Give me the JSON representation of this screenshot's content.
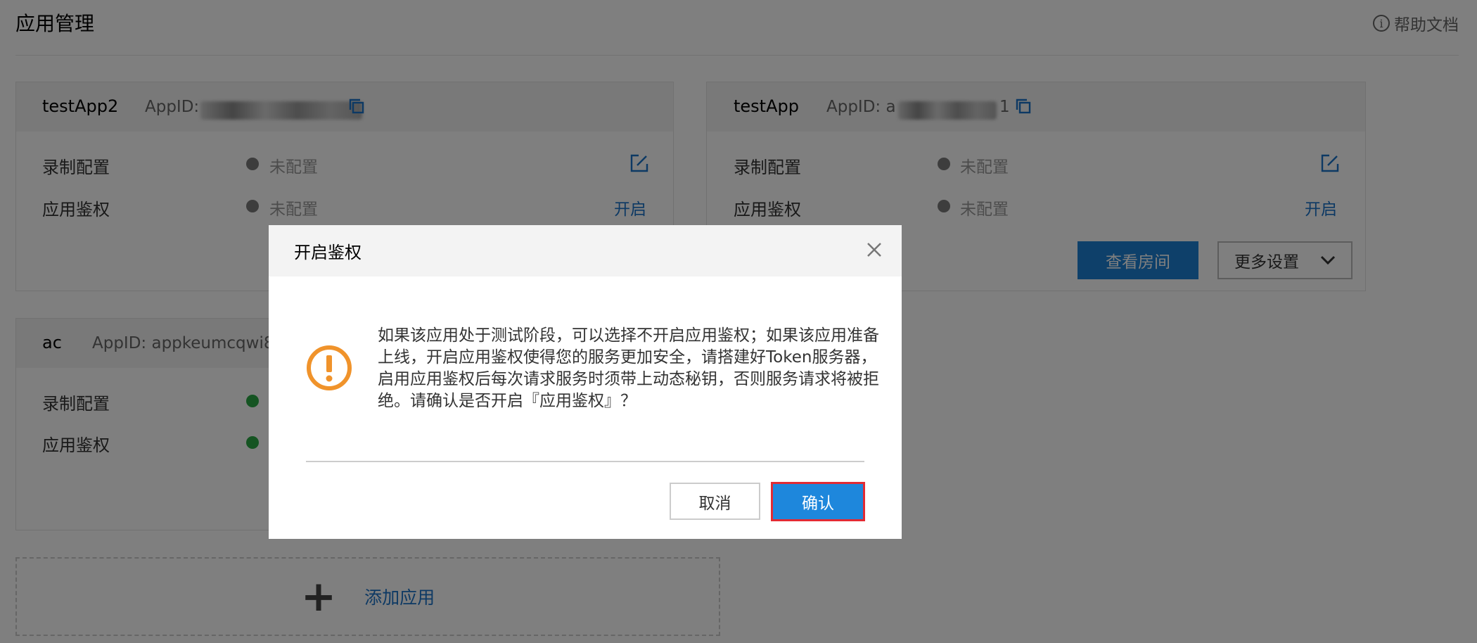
{
  "header": {
    "title": "应用管理",
    "help_label": "帮助文档",
    "help_icon": "info-icon"
  },
  "apps": [
    {
      "name": "testApp2",
      "appid_label": "AppID:",
      "appid_value": "",
      "rows": [
        {
          "label": "录制配置",
          "status": "未配置",
          "status_color": "#7a7a7a",
          "action": "edit-icon"
        },
        {
          "label": "应用鉴权",
          "status": "未配置",
          "status_color": "#7a7a7a",
          "action_label": "开启"
        }
      ]
    },
    {
      "name": "testApp",
      "appid_label": "AppID: a",
      "appid_value": "1",
      "rows": [
        {
          "label": "录制配置",
          "status": "未配置",
          "status_color": "#7a7a7a",
          "action": "edit-icon"
        },
        {
          "label": "应用鉴权",
          "status": "未配置",
          "status_color": "#7a7a7a",
          "action_label": "开启"
        }
      ],
      "buttons": {
        "view_rooms": "查看房间",
        "more_settings": "更多设置"
      }
    },
    {
      "name": "ac",
      "appid_label": "AppID: appkeumcqwi8",
      "rows": [
        {
          "label": "录制配置",
          "status_color": "#2aa845"
        },
        {
          "label": "应用鉴权",
          "status_color": "#2aa845"
        }
      ]
    }
  ],
  "add_app": {
    "label": "添加应用",
    "icon": "plus-icon"
  },
  "modal": {
    "title": "开启鉴权",
    "message": "如果该应用处于测试阶段，可以选择不开启应用鉴权；如果该应用准备上线，开启应用鉴权使得您的服务更加安全，请搭建好Token服务器，启用应用鉴权后每次请求服务时须带上动态秘钥，否则服务请求将被拒绝。请确认是否开启『应用鉴权』？",
    "cancel_label": "取消",
    "confirm_label": "确认",
    "warning_icon": "warning-icon",
    "warning_color": "#f0932b",
    "confirm_color": "#1e87dc",
    "highlight_color": "#e22b34"
  },
  "colors": {
    "link": "#1a73c8",
    "primary_button": "#1d81d5"
  }
}
